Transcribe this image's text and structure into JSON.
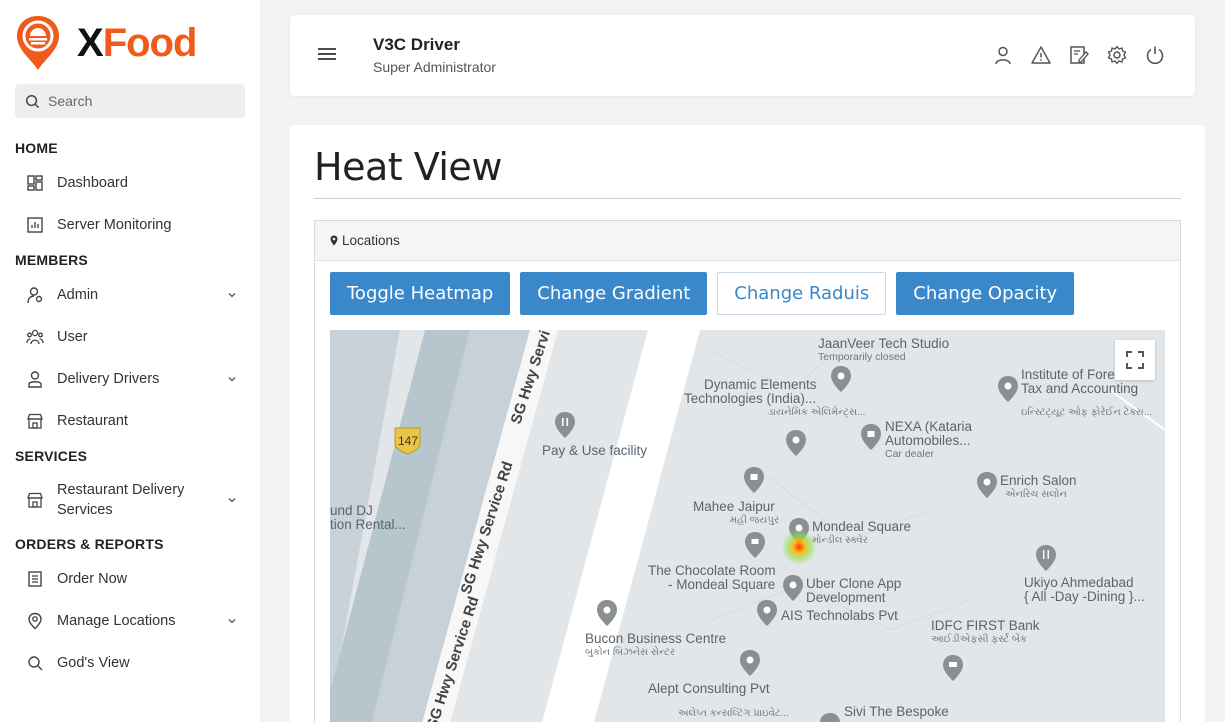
{
  "brand": {
    "x": "X",
    "food": "Food",
    "colors": {
      "orange": "#f05a1a",
      "blue": "#3a87c9"
    }
  },
  "search": {
    "placeholder": "Search"
  },
  "sidebar": {
    "sections": [
      {
        "title": "HOME",
        "items": [
          {
            "label": "Dashboard",
            "icon": "dashboard-icon"
          },
          {
            "label": "Server Monitoring",
            "icon": "monitoring-icon"
          }
        ]
      },
      {
        "title": "MEMBERS",
        "items": [
          {
            "label": "Admin",
            "icon": "admin-icon",
            "expandable": true
          },
          {
            "label": "User",
            "icon": "users-icon"
          },
          {
            "label": "Delivery Drivers",
            "icon": "driver-icon",
            "expandable": true
          },
          {
            "label": "Restaurant",
            "icon": "store-icon"
          }
        ]
      },
      {
        "title": "SERVICES",
        "items": [
          {
            "label": "Restaurant Delivery Services",
            "icon": "store-icon",
            "expandable": true
          }
        ]
      },
      {
        "title": "ORDERS & REPORTS",
        "items": [
          {
            "label": "Order Now",
            "icon": "order-icon"
          },
          {
            "label": "Manage Locations",
            "icon": "location-icon",
            "expandable": true
          },
          {
            "label": "God's View",
            "icon": "view-icon"
          }
        ]
      }
    ]
  },
  "header": {
    "name": "V3C Driver",
    "role": "Super Administrator",
    "icons": [
      "user-icon",
      "alert-icon",
      "edit-icon",
      "settings-icon",
      "power-icon"
    ]
  },
  "page": {
    "title": "Heat View"
  },
  "panel": {
    "title": "Locations"
  },
  "buttons": {
    "toggle": "Toggle Heatmap",
    "gradient": "Change Gradient",
    "radius": "Change Raduis",
    "opacity": "Change Opacity"
  },
  "map": {
    "road_number": "147",
    "road_labels": [
      "SG Hwy Servi",
      "SG Hwy Service Rd",
      "SG Hwy Service Rd"
    ],
    "places": [
      {
        "name": "JaanVeer Tech Studio",
        "sub": "Temporarily closed"
      },
      {
        "name": "Dynamic Elements Technologies (India)...",
        "sub": "ડાયનેમિક એલિમેન્ટ્સ..."
      },
      {
        "name": "Institute of Forei... Tax and Accounting",
        "sub": "ઇન્સ્ટિટ્યૂટ ઓફ ફોરેઈન ટેક્સ..."
      },
      {
        "name": "NEXA (Kataria Automobiles...",
        "sub": "Car dealer"
      },
      {
        "name": "Pay & Use facility",
        "sub": ""
      },
      {
        "name": "Enrich Salon",
        "sub": "એનરિચ સલોન"
      },
      {
        "name": "Mahee Jaipur",
        "sub": "મહી જયપુર"
      },
      {
        "name": "Mondeal Square",
        "sub": "મોન્ડીલ સ્ક્વેર"
      },
      {
        "name": "und DJ tion Rental...",
        "sub": ""
      },
      {
        "name": "The Chocolate Room - Mondeal Square",
        "sub": ""
      },
      {
        "name": "Uber Clone App Development",
        "sub": ""
      },
      {
        "name": "Ukiyo Ahmedabad { All -Day -Dining }...",
        "sub": ""
      },
      {
        "name": "AIS Technolabs Pvt",
        "sub": ""
      },
      {
        "name": "IDFC FIRST Bank",
        "sub": "આઈડીએફસી ફર્સ્ટ બેંક"
      },
      {
        "name": "Bucon Business Centre",
        "sub": "બુકોન બિઝનેસ સેન્ટર"
      },
      {
        "name": "Alept Consulting Pvt",
        "sub": "અલેપ્ત કન્સલ્ટિંગ પ્રાઇવેટ..."
      },
      {
        "name": "Sivi The Bespoke",
        "sub": ""
      }
    ]
  }
}
